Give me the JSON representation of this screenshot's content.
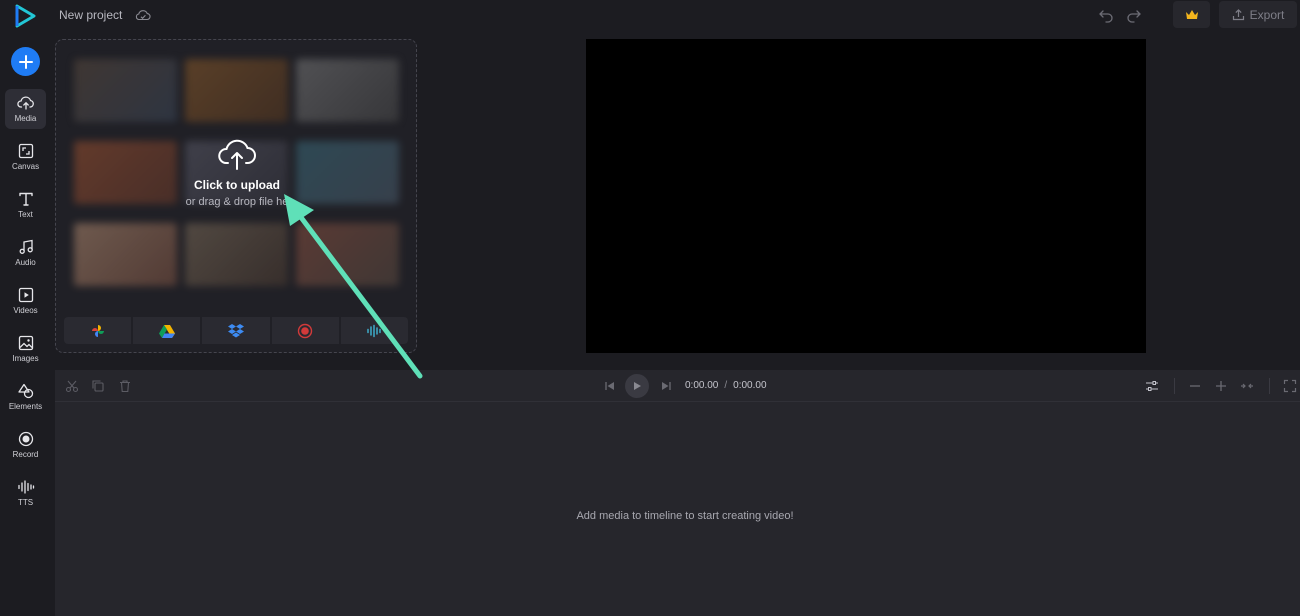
{
  "colors": {
    "background": "#1c1c21",
    "accent_blue": "#1f7cf5",
    "logo_teal": "#22c7d6",
    "annotation_arrow": "#5fe0b8",
    "premium_crown": "#f2b41d"
  },
  "header": {
    "project_title": "New project",
    "cloud_icon": "cloud-sync-icon",
    "export_label": "Export"
  },
  "sidebar": {
    "add_icon": "plus-icon",
    "items": [
      {
        "label": "Media",
        "icon": "upload-cloud-icon",
        "active": true
      },
      {
        "label": "Canvas",
        "icon": "canvas-resize-icon",
        "active": false
      },
      {
        "label": "Text",
        "icon": "text-icon",
        "active": false
      },
      {
        "label": "Audio",
        "icon": "music-note-icon",
        "active": false
      },
      {
        "label": "Videos",
        "icon": "video-icon",
        "active": false
      },
      {
        "label": "Images",
        "icon": "image-icon",
        "active": false
      },
      {
        "label": "Elements",
        "icon": "shapes-icon",
        "active": false
      },
      {
        "label": "Record",
        "icon": "record-icon",
        "active": false
      },
      {
        "label": "TTS",
        "icon": "waveform-icon",
        "active": false
      }
    ]
  },
  "media_panel": {
    "upload_title": "Click to upload",
    "upload_subtitle": "or drag & drop file he",
    "sources": [
      "google-photos-icon",
      "google-drive-icon",
      "dropbox-icon",
      "record-screen-icon",
      "tts-audio-icon"
    ]
  },
  "timeline": {
    "current_time": "0:00.00",
    "separator": "/",
    "total_time": "0:00.00",
    "empty_message": "Add media to timeline to start creating video!"
  }
}
